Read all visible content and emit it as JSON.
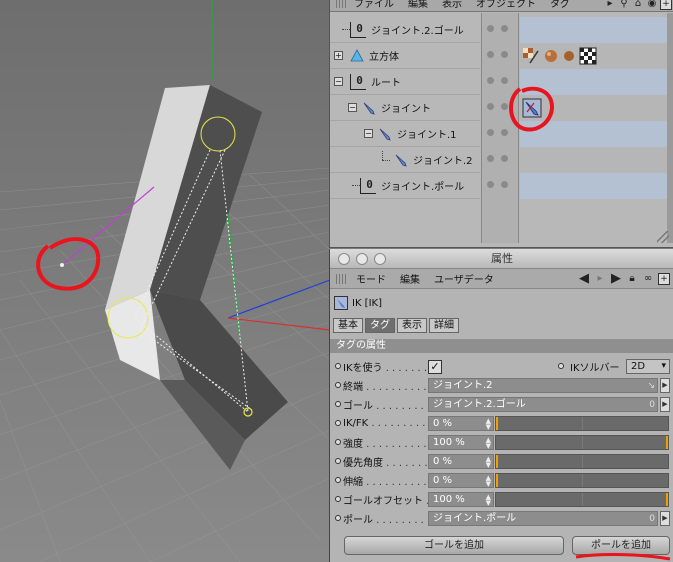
{
  "object_manager": {
    "menu": [
      "ファイル",
      "編集",
      "表示",
      "オブジェクト",
      "タグ"
    ],
    "tool_icons": [
      "play-arrow-icon",
      "search-icon",
      "home-icon",
      "eye-icon",
      "new-window-icon"
    ],
    "rows": [
      {
        "label": "ジョイント.2.ゴール",
        "icon": "null-object-icon",
        "indent": 0,
        "expand": ""
      },
      {
        "label": "立方体",
        "icon": "cube-icon",
        "indent": 0,
        "expand": "+"
      },
      {
        "label": "ルート",
        "icon": "null-object-icon",
        "indent": 0,
        "expand": "−"
      },
      {
        "label": "ジョイント",
        "icon": "joint-icon",
        "indent": 1,
        "expand": "−"
      },
      {
        "label": "ジョイント.1",
        "icon": "joint-icon",
        "indent": 2,
        "expand": "−"
      },
      {
        "label": "ジョイント.2",
        "icon": "joint-icon",
        "indent": 3,
        "expand": ""
      },
      {
        "label": "ジョイント.ポール",
        "icon": "null-object-icon",
        "indent": 1,
        "expand": ""
      }
    ],
    "null_glyph": "0"
  },
  "attributes": {
    "window_title": "属性",
    "menu": [
      "モード",
      "編集",
      "ユーザデータ"
    ],
    "object_label": "IK [IK]",
    "tabs": [
      "基本",
      "タグ",
      "表示",
      "詳細"
    ],
    "active_tab": "タグ",
    "section_title": "タグの属性",
    "use_ik_label": "IKを使う",
    "use_ik_checked": true,
    "check_glyph": "✓",
    "solver_label": "IKソルバー",
    "solver_value": "2D",
    "end_label": "終端",
    "end_value": "ジョイント.2",
    "goal_label": "ゴール",
    "goal_value": "ジョイント.2.ゴール",
    "ikfk_label": "IK/FK",
    "ikfk_value": "0 %",
    "ikfk_fraction": 0,
    "strength_label": "強度",
    "strength_value": "100 %",
    "strength_fraction": 1,
    "pref_angle_label": "優先角度",
    "pref_angle_value": "0 %",
    "pref_angle_fraction": 0,
    "stretch_label": "伸縮",
    "stretch_value": "0 %",
    "stretch_fraction": 0,
    "goal_offset_label": "ゴールオフセット",
    "goal_offset_value": "100 %",
    "goal_offset_fraction": 1,
    "pole_label": "ポール",
    "pole_value": "ジョイント.ポール",
    "add_goal_button": "ゴールを追加",
    "add_pole_button": "ポールを追加"
  },
  "colors": {
    "annotation": "#e8141e",
    "slider_knob": "#f0a000",
    "tag_row_blue": "#b4c1d3"
  }
}
